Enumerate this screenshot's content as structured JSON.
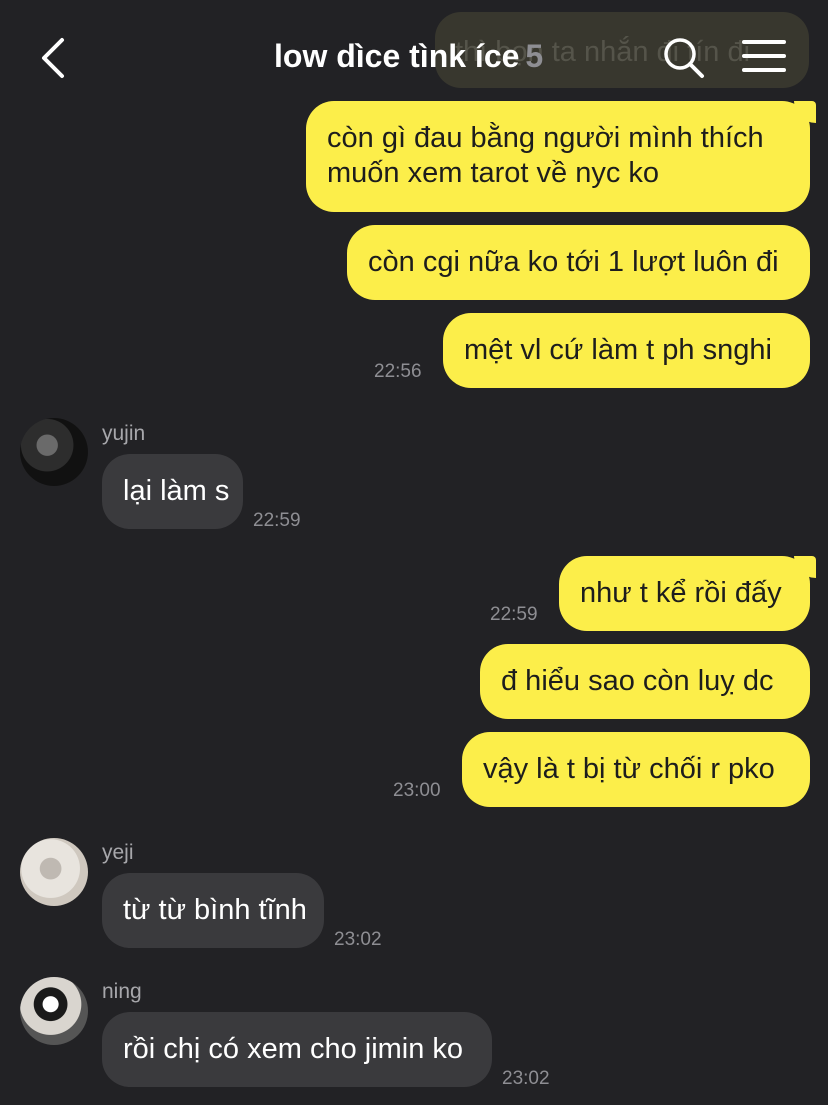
{
  "header": {
    "title": "low dìce tìnk íce",
    "member_count": "5",
    "ghost_message": "thì bọn ta nhắn đi tín đi"
  },
  "messages": [
    {
      "sender": "me",
      "text_lines": [
        "còn gì đau bằng người mình thích",
        "muốn xem tarot về nyc ko"
      ]
    },
    {
      "sender": "me",
      "text": "còn cgi nữa ko tới 1 lượt luôn đi"
    },
    {
      "sender": "me",
      "text": "mệt vl cứ làm t ph snghi",
      "time": "22:56"
    },
    {
      "sender": "yujin",
      "name": "yujin",
      "text": "lại làm s",
      "time": "22:59"
    },
    {
      "sender": "me",
      "text": "như t kể rồi đấy",
      "time": "22:59"
    },
    {
      "sender": "me",
      "text": "đ hiểu sao còn luỵ dc"
    },
    {
      "sender": "me",
      "text": "vậy là t bị từ chối r pko",
      "time": "23:00"
    },
    {
      "sender": "yeji",
      "name": "yeji",
      "text": "từ từ bình tĩnh",
      "time": "23:02"
    },
    {
      "sender": "ning",
      "name": "ning",
      "text": "rồi chị có xem cho jimin ko",
      "time": "23:02"
    }
  ]
}
